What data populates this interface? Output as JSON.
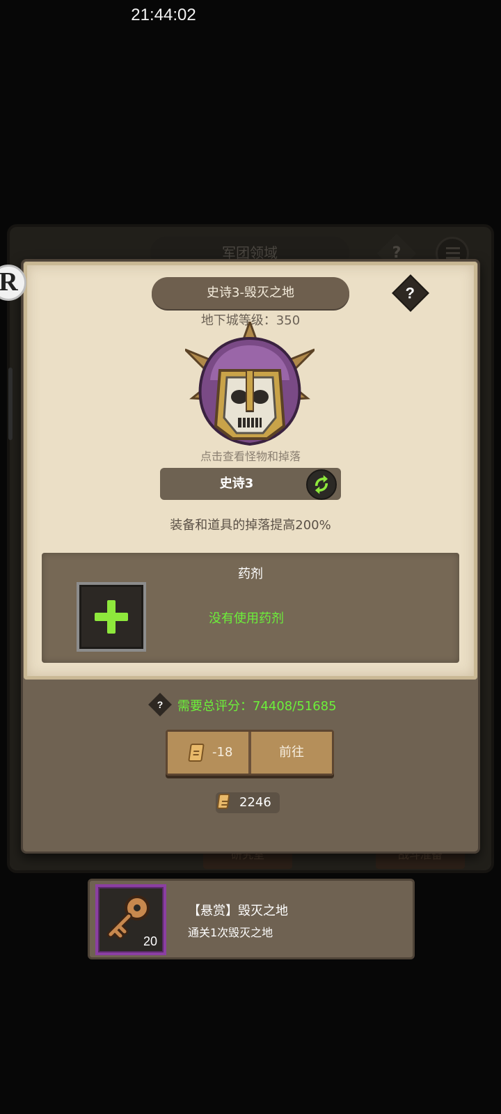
{
  "status_bar": {
    "time": "21:44:02"
  },
  "background": {
    "title": "军团领域",
    "help": "?",
    "buttons": [
      "研究室",
      "战斗准备"
    ]
  },
  "dialog": {
    "title": "史诗3-毁灭之地",
    "help": "?",
    "dungeon_level": "地下城等级：350",
    "monster_hint": "点击查看怪物和掉落",
    "difficulty": "史诗3",
    "bonus": "装备和道具的掉落提高200%",
    "potion": {
      "title": "药剂",
      "empty_text": "没有使用药剂"
    },
    "requirement": {
      "help": "?",
      "text": "需要总评分：74408/51685",
      "color": "#6cf03a"
    },
    "go": {
      "cost": "-18",
      "label": "前往"
    },
    "tickets": "2246"
  },
  "bounty": {
    "count": "20",
    "title": "【悬赏】毁灭之地",
    "desc": "通关1次毁灭之地",
    "frame_color": "#8b3fa2"
  }
}
